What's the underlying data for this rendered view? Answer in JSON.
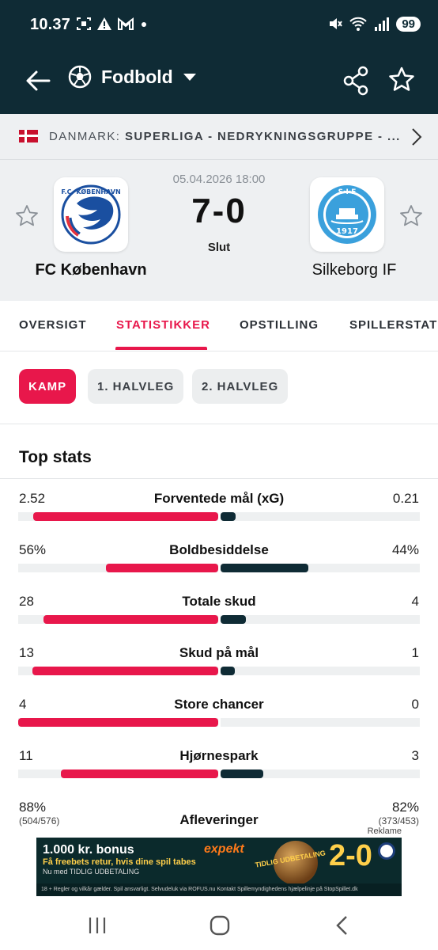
{
  "status_bar": {
    "time": "10.37",
    "battery": "99",
    "icons_left": [
      "screenshot-icon",
      "warning-icon",
      "gmail-icon",
      "dot-icon"
    ],
    "icons_right": [
      "mute-icon",
      "wifi-icon",
      "signal-icon"
    ]
  },
  "app_bar": {
    "title": "Fodbold",
    "icons": [
      "back-arrow-icon",
      "soccer-ball-icon",
      "caret-down-icon",
      "share-icon",
      "star-icon"
    ]
  },
  "league": {
    "country": "DANMARK: ",
    "name": "SUPERLIGA - NEDRYKNINGSGRUPPE - ..."
  },
  "match": {
    "datetime": "05.04.2026 18:00",
    "score": "7-0",
    "status": "Slut",
    "home_team": "FC København",
    "away_team": "Silkeborg IF",
    "home_crest_text": "F.C. KØBENHAVN",
    "away_crest_text": "S·I·F",
    "away_crest_year": "1917"
  },
  "tabs": [
    {
      "label": "OVERSIGT",
      "active": false
    },
    {
      "label": "STATISTIKKER",
      "active": true
    },
    {
      "label": "OPSTILLING",
      "active": false
    },
    {
      "label": "SPILLERSTATI",
      "active": false
    }
  ],
  "period_chips": [
    {
      "label": "KAMP",
      "active": true
    },
    {
      "label": "1. HALVLEG",
      "active": false
    },
    {
      "label": "2. HALVLEG",
      "active": false
    }
  ],
  "stats": {
    "title": "Top stats",
    "rows": [
      {
        "label": "Forventede mål (xG)",
        "home": "2.52",
        "away": "0.21",
        "home_fill": 0.923,
        "away_fill": 0.077
      },
      {
        "label": "Boldbesiddelse",
        "home": "56%",
        "away": "44%",
        "home_fill": 0.56,
        "away_fill": 0.44
      },
      {
        "label": "Totale skud",
        "home": "28",
        "away": "4",
        "home_fill": 0.875,
        "away_fill": 0.125
      },
      {
        "label": "Skud på mål",
        "home": "13",
        "away": "1",
        "home_fill": 0.929,
        "away_fill": 0.071
      },
      {
        "label": "Store chancer",
        "home": "4",
        "away": "0",
        "home_fill": 1.0,
        "away_fill": 0.0
      },
      {
        "label": "Hjørnespark",
        "home": "11",
        "away": "3",
        "home_fill": 0.786,
        "away_fill": 0.214
      },
      {
        "label": "Afleveringer",
        "home": "88%",
        "away": "82%",
        "home_sub": "(504/576)",
        "away_sub": "(373/453)"
      }
    ]
  },
  "ad": {
    "label": "Reklame",
    "headline": "1.000 kr. bonus",
    "line2": "Få freebets retur, hvis dine spil tabes",
    "line3": "Nu med TIDLIG UDBETALING",
    "brand": "expekt",
    "badge": "TIDLIG UDBETALING",
    "score": "2-0",
    "legal": "18 + Regler og vilkår gælder. Spil ansvarligt. Selvudeluk via ROFUS.nu Kontakt Spillemyndighedens hjælpelinje på StopSpillet.dk"
  },
  "colors": {
    "accent": "#e8174b",
    "dark": "#0f2b35",
    "track": "#eef0f1",
    "header_bg": "#eef0f2"
  }
}
